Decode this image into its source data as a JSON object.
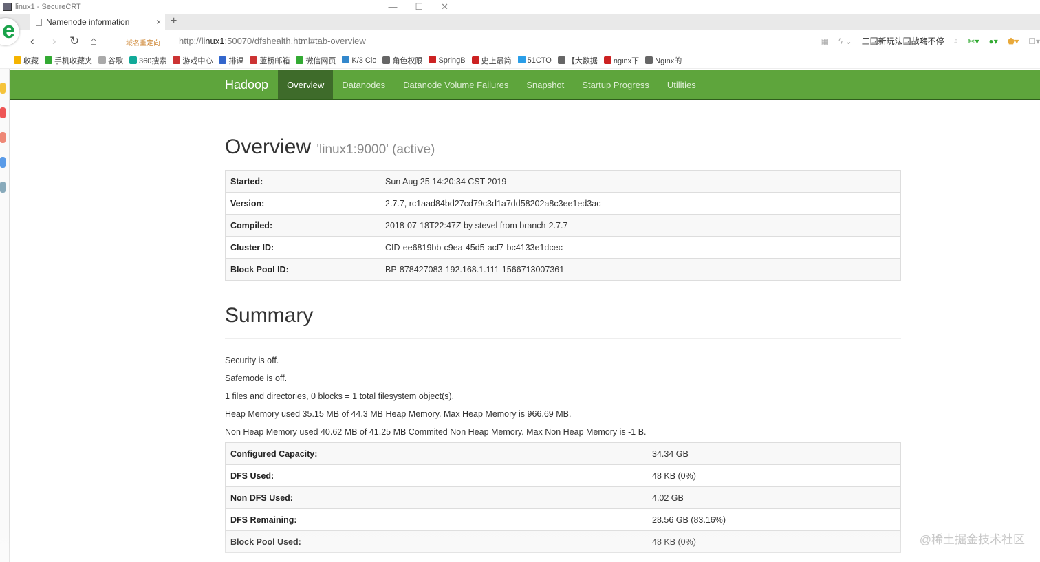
{
  "window": {
    "title": "linux1 - SecureCRT"
  },
  "browser": {
    "tab_title": "Namenode information",
    "redirect_label": "域名重定向",
    "url_prefix": "http://",
    "url_host": "linux1",
    "url_rest": ":50070/dfshealth.html#tab-overview",
    "search_text": "三国新玩法国战嗨不停"
  },
  "bookmarks": [
    "收藏",
    "手机收藏夹",
    "谷歌",
    "360搜索",
    "游戏中心",
    "排课",
    "蓝桥邮箱",
    "微信网页",
    "K/3 Clo",
    "角色权限",
    "SpringB",
    "史上最简",
    "51CTO",
    "【大数据",
    "nginx下",
    "Nginx的"
  ],
  "nav": {
    "brand": "Hadoop",
    "items": [
      "Overview",
      "Datanodes",
      "Datanode Volume Failures",
      "Snapshot",
      "Startup Progress",
      "Utilities"
    ],
    "active": "Overview",
    "colors": {
      "bar": "#5ea53c",
      "active": "#3e6b2a"
    }
  },
  "overview": {
    "title": "Overview",
    "subtitle": "'linux1:9000' (active)",
    "rows": [
      [
        "Started:",
        "Sun Aug 25 14:20:34 CST 2019"
      ],
      [
        "Version:",
        "2.7.7, rc1aad84bd27cd79c3d1a7dd58202a8c3ee1ed3ac"
      ],
      [
        "Compiled:",
        "2018-07-18T22:47Z by stevel from branch-2.7.7"
      ],
      [
        "Cluster ID:",
        "CID-ee6819bb-c9ea-45d5-acf7-bc4133e1dcec"
      ],
      [
        "Block Pool ID:",
        "BP-878427083-192.168.1.111-1566713007361"
      ]
    ]
  },
  "summary": {
    "title": "Summary",
    "lines": [
      "Security is off.",
      "Safemode is off.",
      "1 files and directories, 0 blocks = 1 total filesystem object(s).",
      "Heap Memory used 35.15 MB of 44.3 MB Heap Memory. Max Heap Memory is 966.69 MB.",
      "Non Heap Memory used 40.62 MB of 41.25 MB Commited Non Heap Memory. Max Non Heap Memory is -1 B."
    ],
    "rows": [
      [
        "Configured Capacity:",
        "34.34 GB"
      ],
      [
        "DFS Used:",
        "48 KB (0%)"
      ],
      [
        "Non DFS Used:",
        "4.02 GB"
      ],
      [
        "DFS Remaining:",
        "28.56 GB (83.16%)"
      ],
      [
        "Block Pool Used:",
        "48 KB (0%)"
      ]
    ]
  },
  "watermark": "@稀土掘金技术社区"
}
